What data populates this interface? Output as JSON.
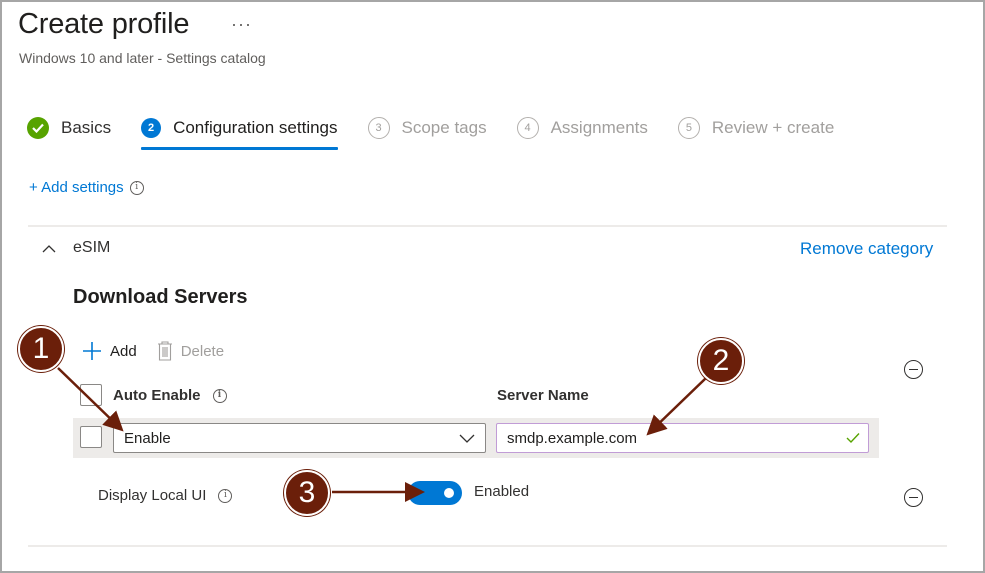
{
  "header": {
    "title": "Create profile",
    "more_label": "···",
    "subtitle": "Windows 10 and later - Settings catalog"
  },
  "wizard": {
    "steps": [
      {
        "number": "✓",
        "label": "Basics",
        "state": "completed"
      },
      {
        "number": "2",
        "label": "Configuration settings",
        "state": "active"
      },
      {
        "number": "3",
        "label": "Scope tags",
        "state": "upcoming"
      },
      {
        "number": "4",
        "label": "Assignments",
        "state": "upcoming"
      },
      {
        "number": "5",
        "label": "Review + create",
        "state": "upcoming"
      }
    ]
  },
  "add_settings": {
    "label": "+ Add settings",
    "info_icon": "info-icon"
  },
  "category": {
    "name": "eSIM",
    "expanded": true,
    "remove_label": "Remove category",
    "section_title": "Download Servers",
    "toolbar": {
      "add_label": "Add",
      "delete_label": "Delete"
    },
    "table": {
      "columns": [
        {
          "label": "Auto Enable",
          "has_info": true
        },
        {
          "label": "Server Name",
          "has_info": false
        }
      ],
      "rows": [
        {
          "auto_enable": "Enable",
          "server_name": "smdp.example.com",
          "server_valid": true
        }
      ]
    },
    "display_local_ui": {
      "label": "Display Local UI",
      "toggle_on": true,
      "state_label": "Enabled"
    }
  },
  "callouts": [
    "1",
    "2",
    "3"
  ],
  "colors": {
    "accent": "#0078d4",
    "success": "#57a300",
    "callout": "#6b1f0a",
    "valid_field_border": "#c19cd6"
  }
}
